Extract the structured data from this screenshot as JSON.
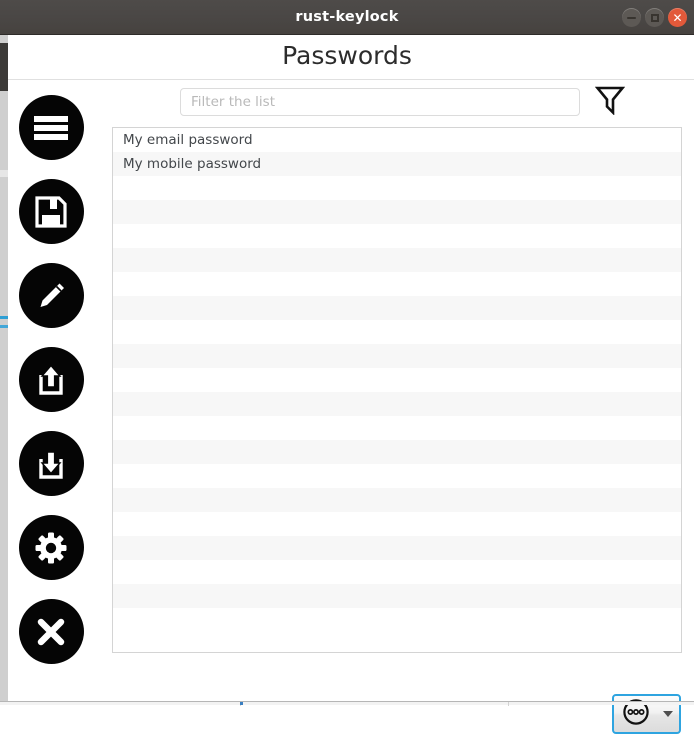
{
  "window": {
    "title": "rust-keylock",
    "controls": [
      {
        "name": "minimize",
        "glyph": "—"
      },
      {
        "name": "maximize",
        "glyph": "□"
      },
      {
        "name": "close",
        "glyph": "✕"
      }
    ],
    "titlebar_bg": "#4a4745",
    "close_btn_color": "#e2593a"
  },
  "page": {
    "title": "Passwords"
  },
  "filter": {
    "value": "",
    "placeholder": "Filter the list",
    "icon": "funnel-icon",
    "icon_label": "Filter"
  },
  "sidebar": {
    "items": [
      {
        "icon": "hamburger-menu-icon",
        "label": "Main menu"
      },
      {
        "icon": "save-floppy-icon",
        "label": "Save"
      },
      {
        "icon": "pencil-edit-icon",
        "label": "Edit"
      },
      {
        "icon": "export-upload-icon",
        "label": "Export"
      },
      {
        "icon": "import-download-icon",
        "label": "Import"
      },
      {
        "icon": "gear-settings-icon",
        "label": "Settings"
      },
      {
        "icon": "close-x-icon",
        "label": "Exit"
      }
    ]
  },
  "list": {
    "items": [
      "My email password",
      "My mobile password"
    ],
    "total_rows": 21,
    "row_bg_odd": "#ffffff",
    "row_bg_even": "#f7f7f7"
  },
  "menu_button": {
    "icon": "three-dots-circle-icon",
    "caret": "chevron-down-icon",
    "focus_color": "#2ea4e0"
  }
}
